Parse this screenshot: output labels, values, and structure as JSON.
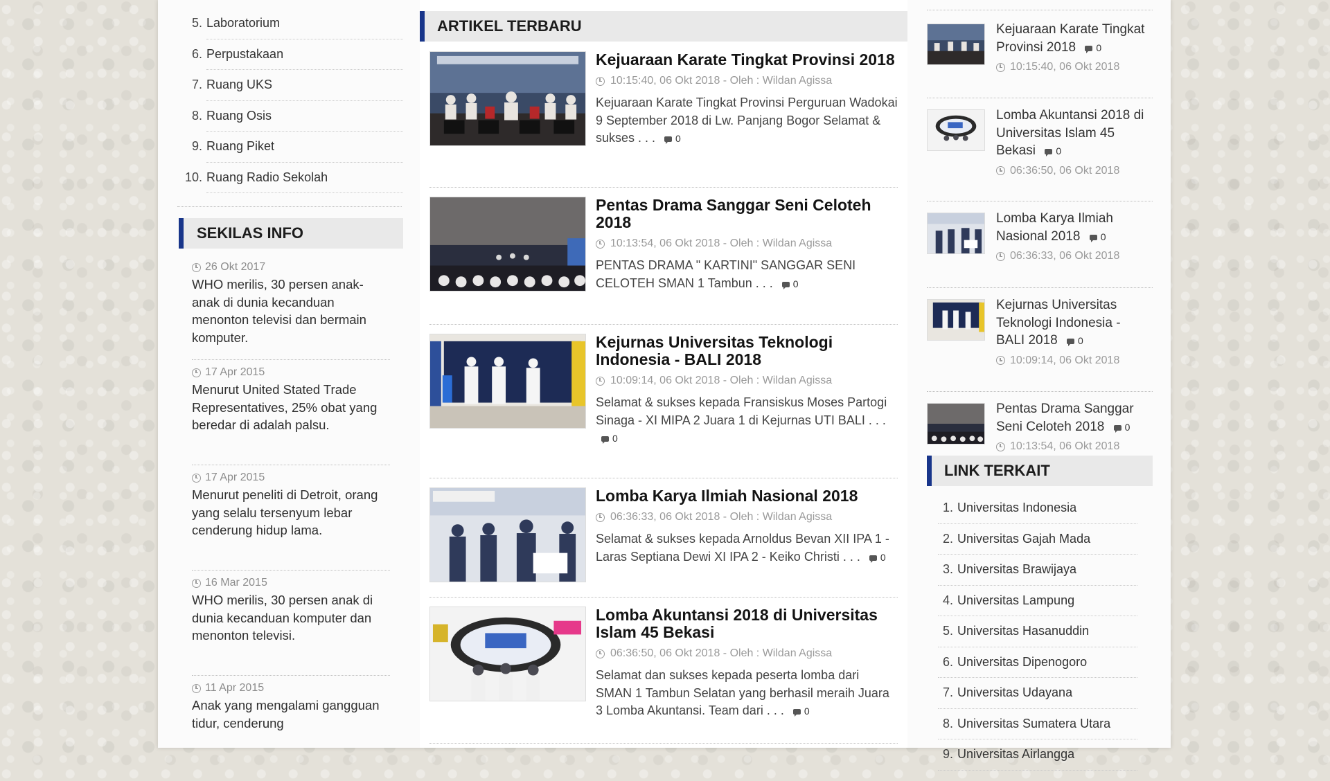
{
  "left": {
    "rooms": [
      {
        "num": "5.",
        "label": "Laboratorium"
      },
      {
        "num": "6.",
        "label": "Perpustakaan"
      },
      {
        "num": "7.",
        "label": "Ruang UKS"
      },
      {
        "num": "8.",
        "label": "Ruang Osis"
      },
      {
        "num": "9.",
        "label": "Ruang Piket"
      },
      {
        "num": "10.",
        "label": "Ruang Radio Sekolah"
      }
    ],
    "info_title": "SEKILAS INFO",
    "info": [
      {
        "date": "26 Okt 2017",
        "text": "WHO merilis, 30 persen anak-anak di dunia kecanduan menonton televisi dan bermain komputer."
      },
      {
        "date": "17 Apr 2015",
        "text": "Menurut United Stated Trade Representatives, 25% obat yang beredar di adalah palsu."
      },
      {
        "date": "17 Apr 2015",
        "text": "Menurut peneliti di Detroit, orang yang selalu tersenyum lebar cenderung hidup lama."
      },
      {
        "date": "16 Mar 2015",
        "text": "WHO merilis, 30 persen anak di dunia kecanduan komputer dan menonton televisi."
      },
      {
        "date": "11 Apr 2015",
        "text": "Anak yang mengalami gangguan tidur, cenderung"
      }
    ]
  },
  "center": {
    "title": "ARTIKEL TERBARU",
    "articles": [
      {
        "title": "Kejuaraan Karate Tingkat Provinsi 2018",
        "meta": "10:15:40, 06 Okt 2018 - Oleh : Wildan Agissa",
        "excerpt": "Kejuaraan Karate Tingkat Provinsi Perguruan Wadokai 9 September 2018 di Lw. Panjang Bogor Selamat & sukses . . .",
        "comments": "0",
        "thumb": "karate"
      },
      {
        "title": "Pentas Drama Sanggar Seni Celoteh 2018",
        "meta": "10:13:54, 06 Okt 2018 - Oleh : Wildan Agissa",
        "excerpt": "PENTAS DRAMA \" KARTINI\" SANGGAR SENI CELOTEH SMAN 1 Tambun . . .",
        "comments": "0",
        "thumb": "drama"
      },
      {
        "title": "Kejurnas Universitas Teknologi Indonesia - BALI 2018",
        "meta": "10:09:14, 06 Okt 2018 - Oleh : Wildan Agissa",
        "excerpt": "Selamat & sukses kepada Fransiskus Moses Partogi Sinaga - XI MIPA 2 Juara 1 di Kejurnas UTI BALI . . .",
        "comments": "0",
        "thumb": "kejurnas"
      },
      {
        "title": "Lomba Karya Ilmiah Nasional 2018",
        "meta": "06:36:33, 06 Okt 2018 - Oleh : Wildan Agissa",
        "excerpt": "Selamat & sukses kepada Arnoldus Bevan XII IPA 1 - Laras Septiana Dewi XI IPA 2 - Keiko Christi . . .",
        "comments": "0",
        "thumb": "ilmiah"
      },
      {
        "title": "Lomba Akuntansi 2018 di Universitas Islam 45 Bekasi",
        "meta": "06:36:50, 06 Okt 2018 - Oleh : Wildan Agissa",
        "excerpt": "Selamat dan sukses kepada peserta lomba dari SMAN 1 Tambun Selatan yang berhasil meraih Juara 3 Lomba Akuntansi. Team dari . . .",
        "comments": "0",
        "thumb": "akuntansi"
      }
    ]
  },
  "right": {
    "recent": [
      {
        "title": "Kejuaraan Karate Tingkat Provinsi 2018",
        "comments": "0",
        "date": "10:15:40, 06 Okt 2018",
        "thumb": "karate"
      },
      {
        "title": "Lomba Akuntansi 2018 di Universitas Islam 45 Bekasi",
        "comments": "0",
        "date": "06:36:50, 06 Okt 2018",
        "thumb": "akuntansi"
      },
      {
        "title": "Lomba Karya Ilmiah Nasional 2018",
        "comments": "0",
        "date": "06:36:33, 06 Okt 2018",
        "thumb": "ilmiah"
      },
      {
        "title": "Kejurnas Universitas Teknologi Indonesia - BALI 2018",
        "comments": "0",
        "date": "10:09:14, 06 Okt 2018",
        "thumb": "kejurnas"
      },
      {
        "title": "Pentas Drama Sanggar Seni Celoteh 2018",
        "comments": "0",
        "date": "10:13:54, 06 Okt 2018",
        "thumb": "drama"
      }
    ],
    "links_title": "LINK TERKAIT",
    "links": [
      {
        "num": "1.",
        "label": "Universitas Indonesia"
      },
      {
        "num": "2.",
        "label": "Universitas Gajah Mada"
      },
      {
        "num": "3.",
        "label": "Universitas Brawijaya"
      },
      {
        "num": "4.",
        "label": "Universitas Lampung"
      },
      {
        "num": "5.",
        "label": "Universitas Hasanuddin"
      },
      {
        "num": "6.",
        "label": "Universitas Dipenogoro"
      },
      {
        "num": "7.",
        "label": "Universitas Udayana"
      },
      {
        "num": "8.",
        "label": "Universitas Sumatera Utara"
      },
      {
        "num": "9.",
        "label": "Universitas Airlangga"
      }
    ]
  },
  "colors": {
    "accent": "#18358a",
    "page_bg": "#fbfbfb",
    "heading_bg": "#e9e9e9"
  }
}
